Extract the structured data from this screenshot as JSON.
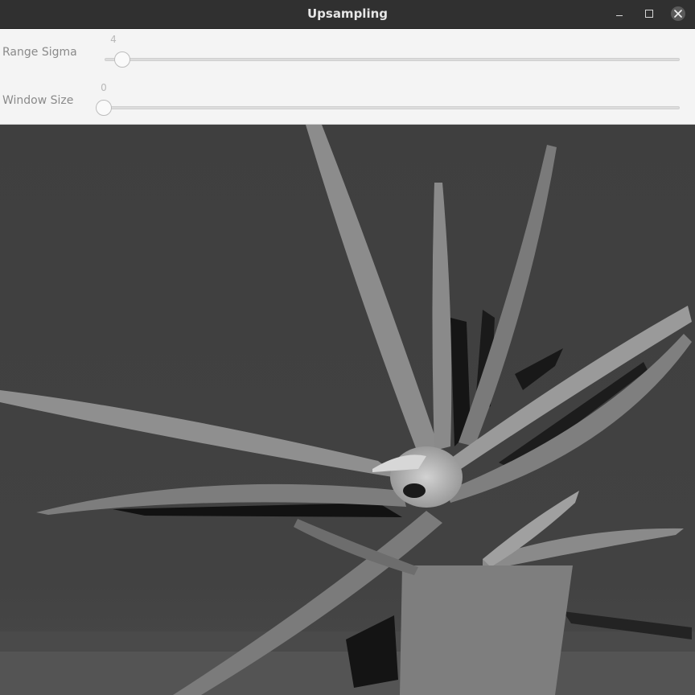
{
  "window": {
    "title": "Upsampling"
  },
  "controls": {
    "trackbars": [
      {
        "label": "Range Sigma",
        "value": "4",
        "fraction": 0.017
      },
      {
        "label": "Window Size",
        "value": "0",
        "fraction": 0.0
      }
    ]
  },
  "image": {
    "description_icon": "depth-map-image"
  },
  "icons": {
    "minimize": "minimize-icon",
    "maximize": "maximize-icon",
    "close": "close-icon"
  }
}
